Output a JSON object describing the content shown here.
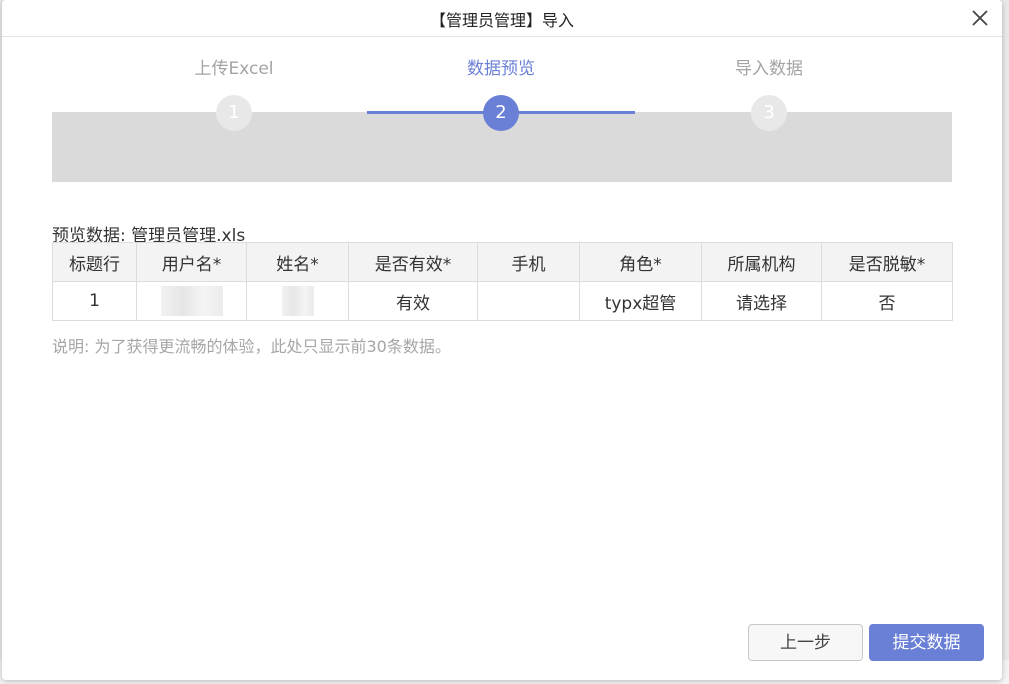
{
  "dialog": {
    "title": "【管理员管理】导入",
    "close_icon": "close-icon"
  },
  "steps": [
    {
      "label": "上传Excel",
      "number": "1",
      "state": "done"
    },
    {
      "label": "数据预览",
      "number": "2",
      "state": "active"
    },
    {
      "label": "导入数据",
      "number": "3",
      "state": "pending"
    }
  ],
  "preview": {
    "caption": "预览数据: 管理员管理.xls",
    "columns": [
      "标题行",
      "用户名*",
      "姓名*",
      "是否有效*",
      "手机",
      "角色*",
      "所属机构",
      "是否脱敏*"
    ],
    "rows": [
      {
        "row": "1",
        "username": "",
        "name": "",
        "valid": "有效",
        "phone": "",
        "role": "typx超管",
        "org": "请选择",
        "desensitize": "否"
      }
    ],
    "note": "说明: 为了获得更流畅的体验，此处只显示前30条数据。"
  },
  "buttons": {
    "prev": "上一步",
    "submit": "提交数据"
  },
  "colors": {
    "accent": "#6a7fd6",
    "inactive_step": "#e8e8e8",
    "band": "#dadada"
  }
}
